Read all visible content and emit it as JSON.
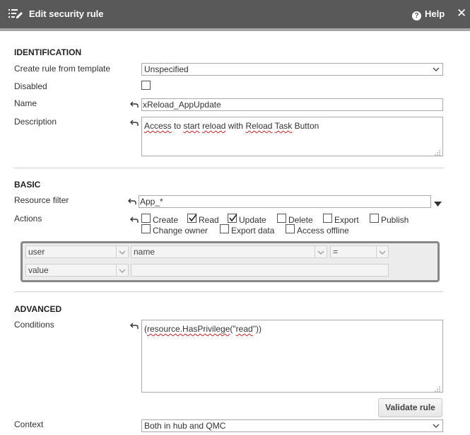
{
  "header": {
    "title": "Edit security rule",
    "help_label": "Help",
    "help_icon_glyph": "?",
    "close_glyph": "✕"
  },
  "identification": {
    "section_title": "IDENTIFICATION",
    "template_label": "Create rule from template",
    "template_value": "Unspecified",
    "disabled_label": "Disabled",
    "disabled_checked": false,
    "name_label": "Name",
    "name_value": "xReload_AppUpdate",
    "description_label": "Description",
    "description_words": [
      "Access",
      " to ",
      "start",
      " ",
      "reload",
      " with ",
      "Reload",
      " ",
      "Task",
      " Button"
    ]
  },
  "basic": {
    "section_title": "BASIC",
    "resource_filter_label": "Resource filter",
    "resource_filter_value": "App_*",
    "actions_label": "Actions",
    "actions": [
      {
        "label": "Create",
        "checked": false
      },
      {
        "label": "Read",
        "checked": true
      },
      {
        "label": "Update",
        "checked": true
      },
      {
        "label": "Delete",
        "checked": false
      },
      {
        "label": "Export",
        "checked": false
      },
      {
        "label": "Publish",
        "checked": false
      },
      {
        "label": "Change owner",
        "checked": false
      },
      {
        "label": "Export data",
        "checked": false
      },
      {
        "label": "Access offline",
        "checked": false
      }
    ],
    "rule_editor": {
      "row1": {
        "type": "user",
        "property": "name",
        "operator": "="
      },
      "row2": {
        "type": "value",
        "value": ""
      }
    }
  },
  "advanced": {
    "section_title": "ADVANCED",
    "conditions_label": "Conditions",
    "conditions_parts": [
      "(",
      "resource.HasPrivilege",
      "(\"",
      "read",
      "\"))"
    ],
    "validate_button": "Validate rule",
    "context_label": "Context",
    "context_value": "Both in hub and QMC"
  },
  "colors": {
    "header_bg": "#595959",
    "header_strip": "#a6a6a6",
    "rule_box_border": "#888888"
  },
  "icons": [
    "list-edit-icon",
    "help-icon",
    "close-icon",
    "undo-arrow-icon",
    "chevron-down-icon",
    "resize-grip-icon",
    "checkmark-icon",
    "dropdown-triangle-icon"
  ]
}
